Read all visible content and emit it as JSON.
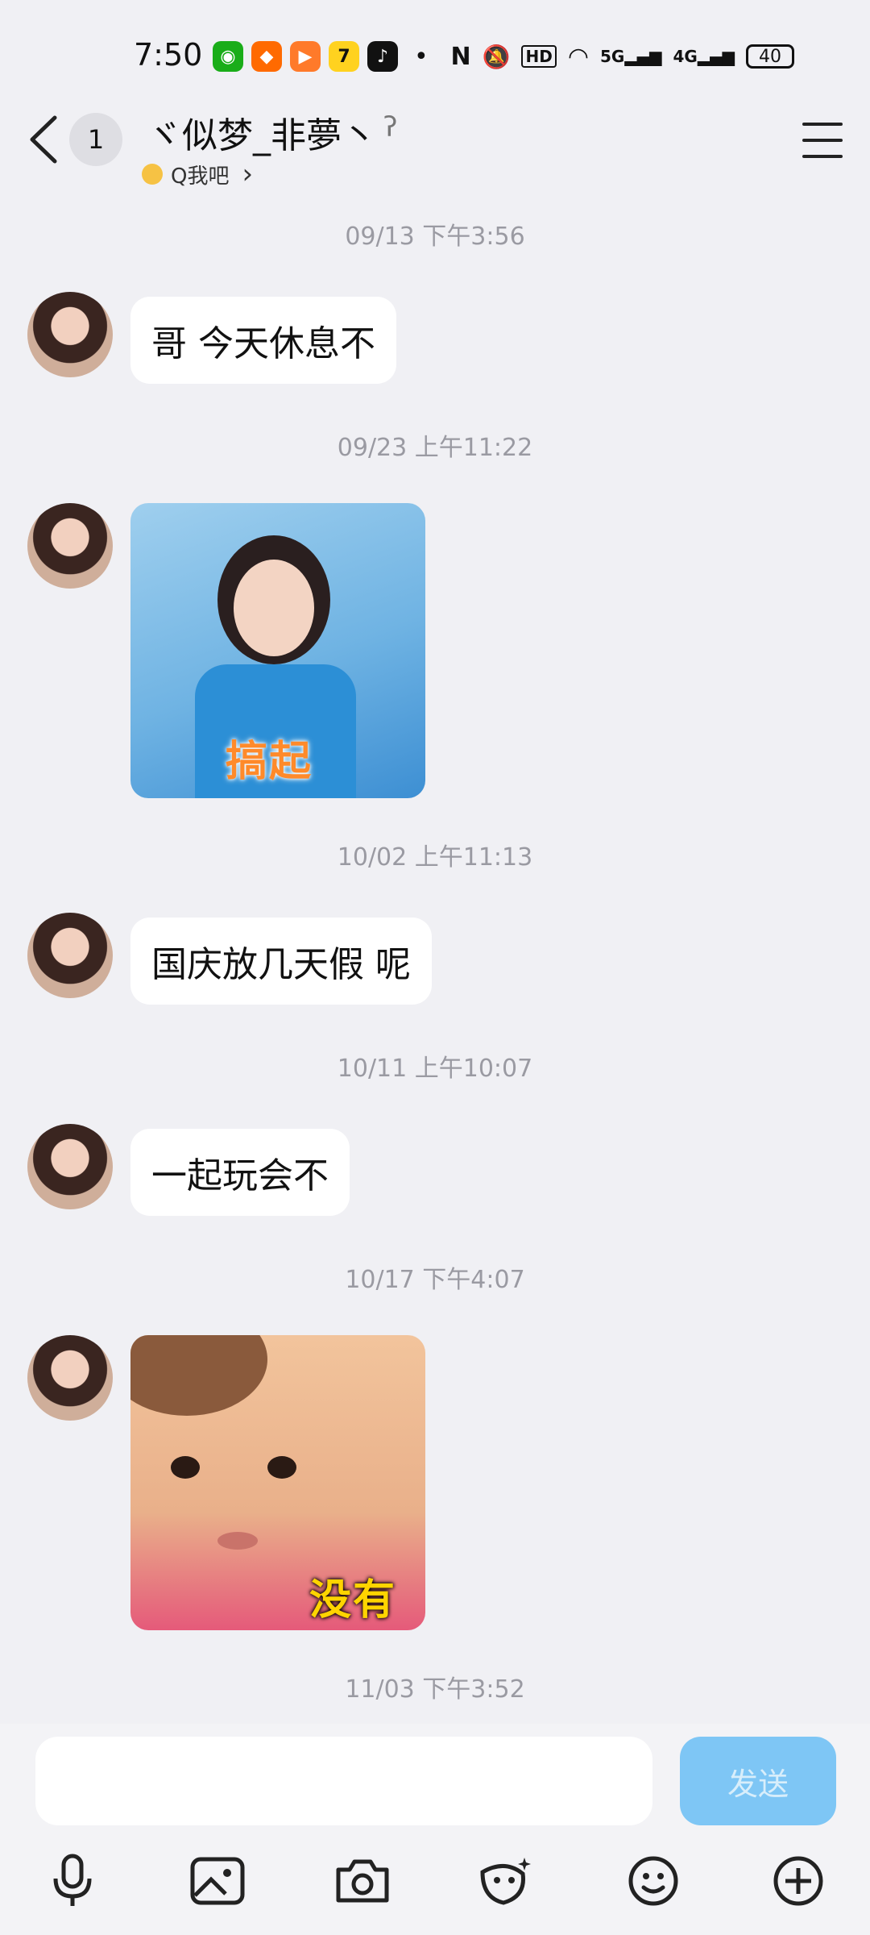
{
  "status_bar": {
    "time": "7:50",
    "dot": "•",
    "hd_label": "HD",
    "net1": "5G",
    "net2": "4G",
    "battery": "40"
  },
  "header": {
    "unread_count": "1",
    "contact_name": "ヾ似梦_非夢丶",
    "status_text": "Q我吧",
    "status_chevron": "›"
  },
  "messages": [
    {
      "timestamp": "09/13 下午3:56",
      "type": "text",
      "text": "哥 今天休息不"
    },
    {
      "timestamp": "09/23 上午11:22",
      "type": "sticker",
      "caption": "搞起"
    },
    {
      "timestamp": "10/02 上午11:13",
      "type": "text",
      "text": "国庆放几天假 呢"
    },
    {
      "timestamp": "10/11 上午10:07",
      "type": "text",
      "text": "一起玩会不"
    },
    {
      "timestamp": "10/17 下午4:07",
      "type": "sticker",
      "caption": "没有"
    },
    {
      "timestamp": "11/03 下午3:52"
    }
  ],
  "composer": {
    "input_value": "",
    "send_label": "发送"
  },
  "toolbar": {
    "items": [
      "microphone-icon",
      "image-icon",
      "camera-icon",
      "sticker-icon",
      "emoji-icon",
      "plus-icon"
    ]
  },
  "colors": {
    "background": "#f0f0f4",
    "send_button": "#7ec6f5",
    "timestamp": "#9a9aa2"
  }
}
